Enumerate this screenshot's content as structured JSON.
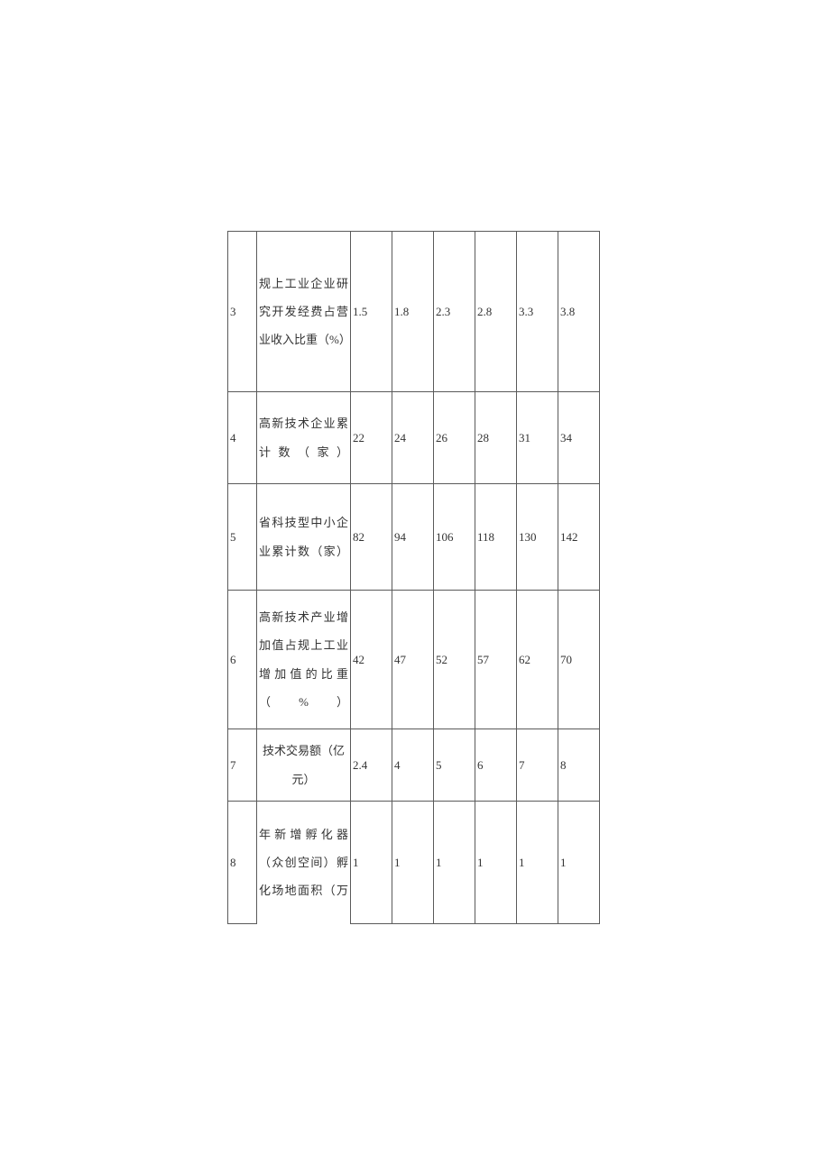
{
  "chart_data": {
    "type": "table",
    "rows": [
      {
        "num": "3",
        "label": "规上工业企业研究开发经费占营业收入比重（%）",
        "values": [
          "1.5",
          "1.8",
          "2.3",
          "2.8",
          "3.3",
          "3.8"
        ]
      },
      {
        "num": "4",
        "label": "高新技术企业累计数（家）",
        "values": [
          "22",
          "24",
          "26",
          "28",
          "31",
          "34"
        ]
      },
      {
        "num": "5",
        "label": "省科技型中小企业累计数（家）",
        "values": [
          "82",
          "94",
          "106",
          "118",
          "130",
          "142"
        ]
      },
      {
        "num": "6",
        "label": "高新技术产业增加值占规上工业增加值的比重（%）",
        "values": [
          "42",
          "47",
          "52",
          "57",
          "62",
          "70"
        ]
      },
      {
        "num": "7",
        "label": "技术交易额（亿元）",
        "values": [
          "2.4",
          "4",
          "5",
          "6",
          "7",
          "8"
        ]
      },
      {
        "num": "8",
        "label": "年新增孵化器（众创空间）孵化场地面积（万",
        "values": [
          "1",
          "1",
          "1",
          "1",
          "1",
          "1"
        ]
      }
    ]
  }
}
